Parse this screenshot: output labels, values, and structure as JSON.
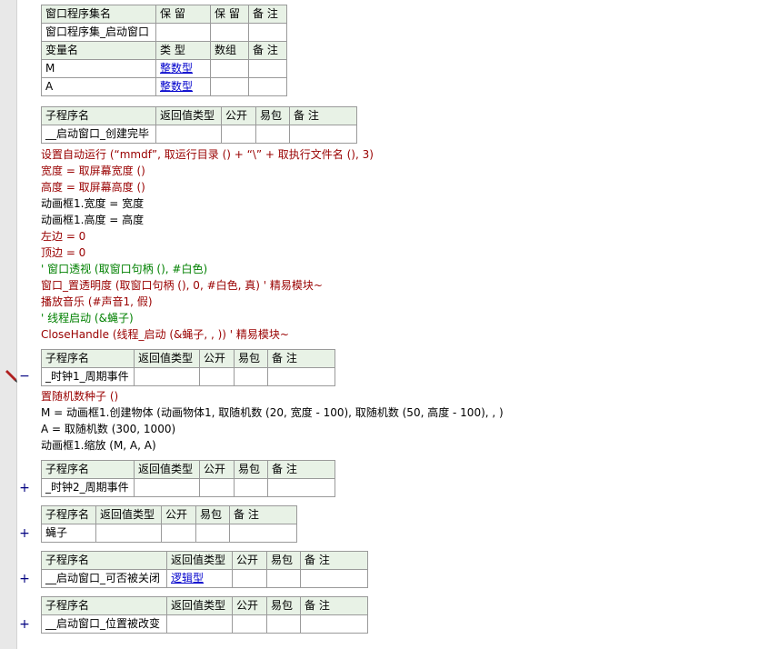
{
  "window_set": {
    "header": [
      "窗口程序集名",
      "保 留",
      "保 留",
      "备 注"
    ],
    "name": "窗口程序集_启动窗口",
    "var_header": [
      "变量名",
      "类 型",
      "数组",
      "备 注"
    ],
    "vars": [
      {
        "name": "M",
        "type": "整数型"
      },
      {
        "name": "A",
        "type": "整数型"
      }
    ]
  },
  "sub_header": [
    "子程序名",
    "返回值类型",
    "公开",
    "易包",
    "备 注"
  ],
  "subs": [
    {
      "name": "__启动窗口_创建完毕",
      "ret": "",
      "toggle": ""
    },
    {
      "name": "_时钟1_周期事件",
      "ret": "",
      "toggle": "−"
    },
    {
      "name": "_时钟2_周期事件",
      "ret": "",
      "toggle": "+"
    },
    {
      "name": "蝇子",
      "ret": "",
      "toggle": "+"
    },
    {
      "name": "__启动窗口_可否被关闭",
      "ret": "逻辑型",
      "toggle": "+"
    },
    {
      "name": "__启动窗口_位置被改变",
      "ret": "",
      "toggle": "+"
    }
  ],
  "code1": [
    {
      "text": "设置自动运行 (“mmdf”, 取运行目录 () + “\\” + 取执行文件名 (), 3)",
      "kind": "cmd"
    },
    {
      "text": "宽度 = 取屏幕宽度 ()",
      "kind": "cmd"
    },
    {
      "text": "高度 = 取屏幕高度 ()",
      "kind": "cmd"
    },
    {
      "text": "动画框1.宽度 = 宽度",
      "kind": "plain"
    },
    {
      "text": "动画框1.高度 = 高度",
      "kind": "plain"
    },
    {
      "text": "左边 = 0",
      "kind": "cmd"
    },
    {
      "text": "顶边 = 0",
      "kind": "cmd"
    },
    {
      "text": "' 窗口透视 (取窗口句柄 (), #白色)",
      "kind": "cmt"
    },
    {
      "text": "窗口_置透明度 (取窗口句柄 (), 0, #白色, 真) ' 精易模块~",
      "kind": "cmd"
    },
    {
      "text": "播放音乐 (#声音1, 假)",
      "kind": "cmd"
    },
    {
      "text": "' 线程启动 (&蝇子)",
      "kind": "cmt"
    },
    {
      "text": "CloseHandle (线程_启动 (&蝇子, , )) ' 精易模块~",
      "kind": "cmd"
    }
  ],
  "code2": [
    {
      "text": "置随机数种子 ()",
      "kind": "cmd"
    },
    {
      "text": "M = 动画框1.创建物体 (动画物体1, 取随机数 (20, 宽度 - 100), 取随机数 (50, 高度 - 100), , )",
      "kind": "plain"
    },
    {
      "text": "A = 取随机数 (300, 1000)",
      "kind": "plain"
    },
    {
      "text": "动画框1.缩放 (M, A, A)",
      "kind": "plain"
    }
  ]
}
